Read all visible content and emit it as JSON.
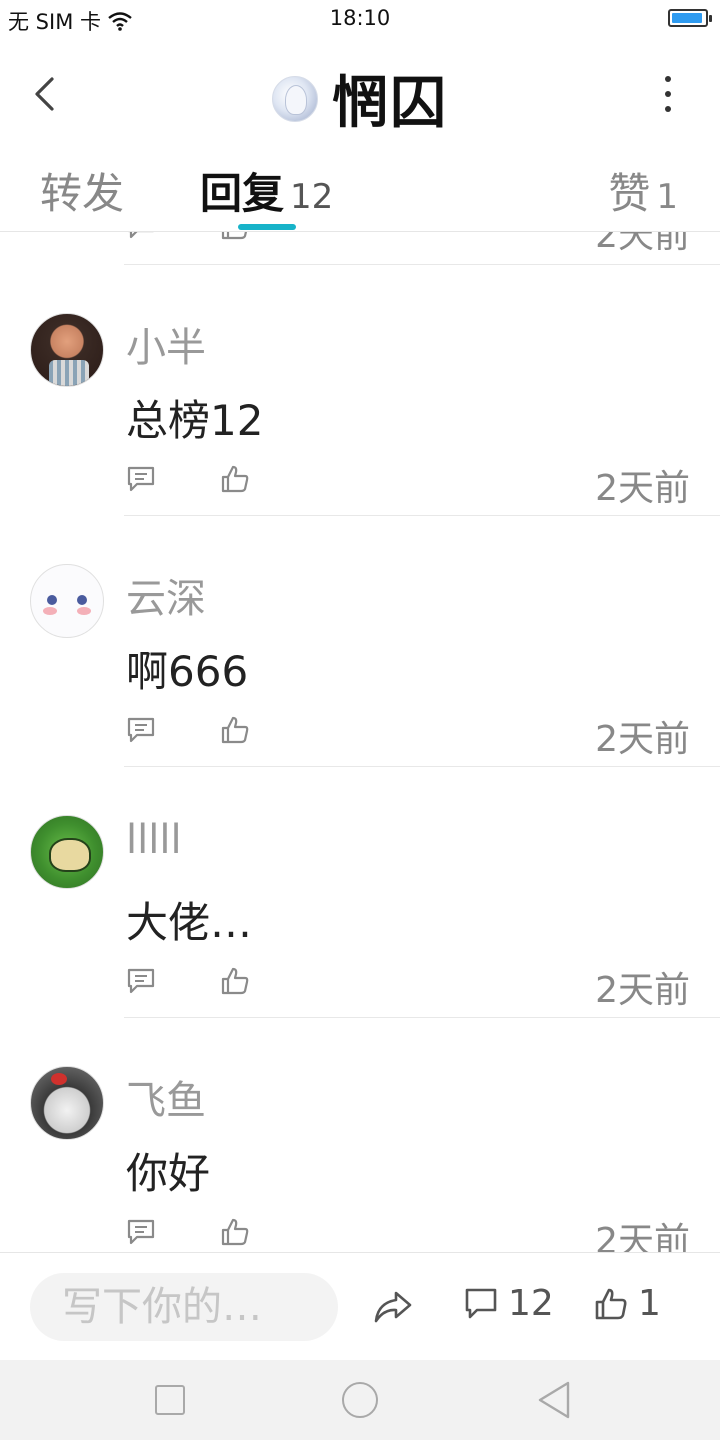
{
  "status_bar": {
    "carrier": "无 SIM 卡",
    "time": "18:10",
    "battery_color": "#2f9bf0"
  },
  "header": {
    "title": "惘囚",
    "back_icon": "chevron-left-icon",
    "more_icon": "more-vertical-icon"
  },
  "tabs": {
    "forward_label": "转发",
    "reply_label": "回复",
    "reply_count": "12",
    "like_label": "赞",
    "like_count": "1",
    "active": "reply",
    "accent_color": "#17b3c9"
  },
  "partial_item": {
    "time": "2天前"
  },
  "comments": [
    {
      "name": "小半",
      "content": "总榜12",
      "time": "2天前"
    },
    {
      "name": "云深",
      "content": "啊666",
      "time": "2天前"
    },
    {
      "name": "lllll",
      "content": "大佬…",
      "time": "2天前"
    },
    {
      "name": "飞鱼",
      "content": "你好",
      "time": "2天前"
    }
  ],
  "bottom_bar": {
    "compose_placeholder": "写下你的…",
    "comment_count": "12",
    "like_count": "1"
  },
  "system_nav": {
    "icons": [
      "recent-apps-icon",
      "home-icon",
      "back-icon"
    ]
  }
}
